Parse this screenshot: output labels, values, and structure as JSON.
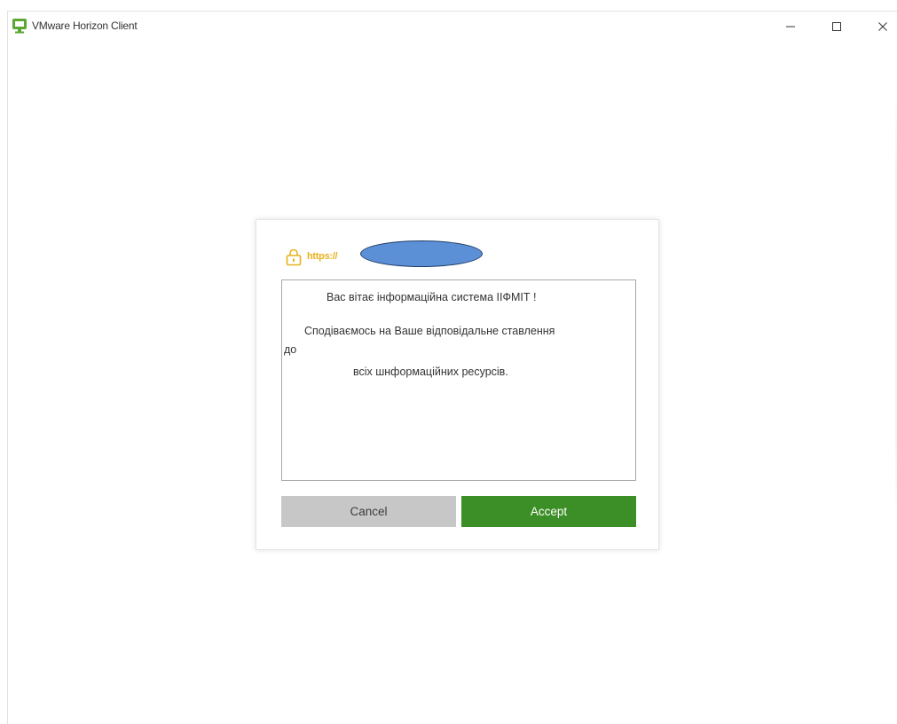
{
  "window": {
    "title": "VMware Horizon Client",
    "controls": {
      "minimize": "minimize-icon",
      "maximize": "maximize-icon",
      "close": "close-icon"
    }
  },
  "dialog": {
    "url": "https://",
    "url_icon": "lock-icon",
    "message_lines": [
      "Вас вітає інформаційна система ІІФМІТ !",
      "Сподіваємось на Ваше відповідальне ставлення",
      "до",
      "всіх шнформаційних ресурсів."
    ],
    "cancel_label": "Cancel",
    "accept_label": "Accept"
  },
  "colors": {
    "accent_green": "#3c8e26",
    "url_yellow": "#e7b21a",
    "cancel_gray": "#c7c7c7",
    "redaction_blue": "#5b8fd6"
  }
}
